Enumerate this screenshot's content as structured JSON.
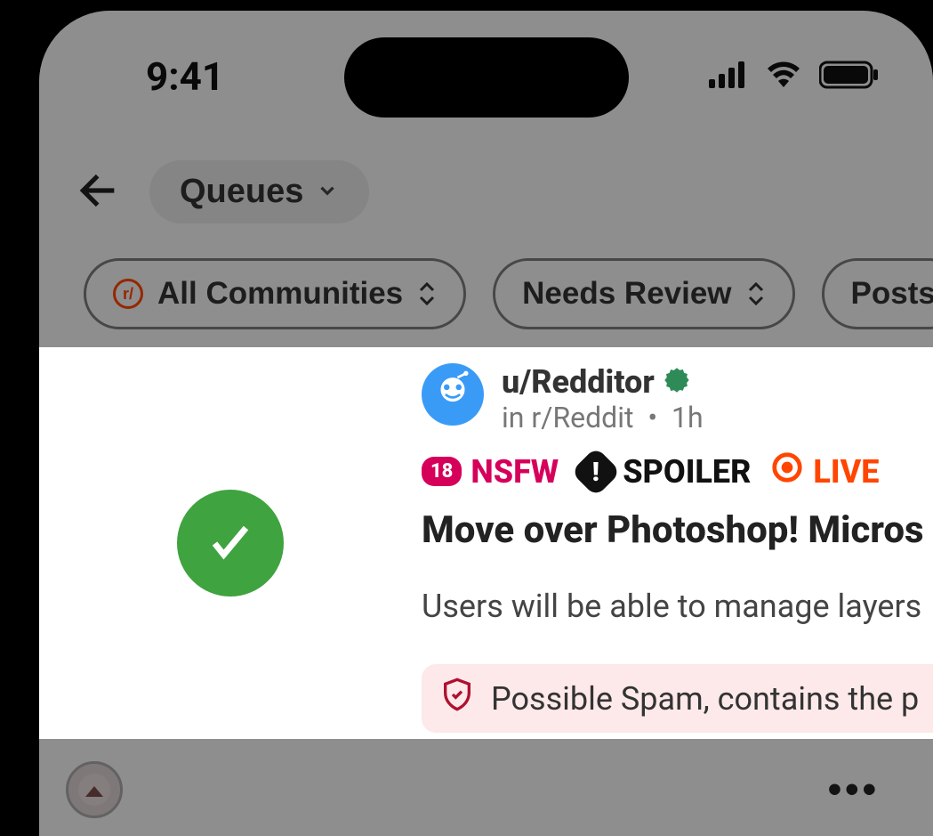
{
  "status": {
    "time": "9:41"
  },
  "header": {
    "title": "Queues"
  },
  "chips": {
    "all": "All Communities",
    "review": "Needs Review",
    "posts": "Posts"
  },
  "post": {
    "username": "u/Redditor",
    "subreddit": "in r/Reddit",
    "sep": "•",
    "age": "1h",
    "tags": {
      "nsfw_badge": "18",
      "nsfw": "NSFW",
      "spoiler": "SPOILER",
      "live": "LIVE"
    },
    "title": "Move over Photoshop! Micros",
    "body": "Users will be able to manage layers",
    "spam": "Possible Spam, contains the p"
  }
}
